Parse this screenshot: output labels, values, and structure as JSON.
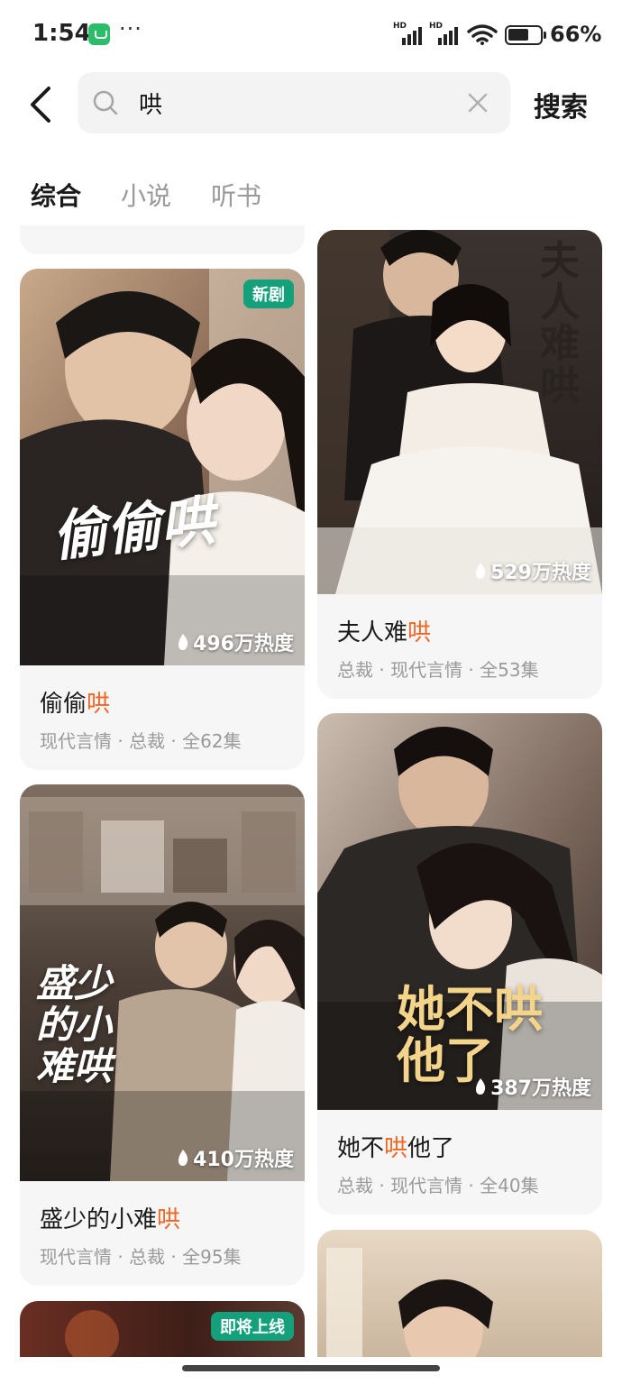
{
  "status_bar": {
    "time": "1:54",
    "dots": "···",
    "signal1": "HD",
    "signal2": "HD",
    "battery_text": "66%"
  },
  "search": {
    "back_icon": "back-chevron-icon",
    "search_icon": "search-icon",
    "query": "哄",
    "clear_icon": "clear-icon",
    "submit_label": "搜索"
  },
  "tabs": [
    {
      "label": "综合",
      "active": true
    },
    {
      "label": "小说",
      "active": false
    },
    {
      "label": "听书",
      "active": false
    }
  ],
  "colors": {
    "highlight": "#f26522",
    "badge_green": "#14a07a",
    "tag_gray": "#9a9a9a"
  },
  "cards": [
    {
      "badge": "新剧",
      "heat": "496万热度",
      "cover_title": "偷偷哄",
      "title_before": "偷偷",
      "title_hl": "哄",
      "title_after": "",
      "tags": "现代言情 · 总裁 · 全62集"
    },
    {
      "badge": "",
      "heat": "529万热度",
      "cover_title": "夫人难哄",
      "title_before": "夫人难",
      "title_hl": "哄",
      "title_after": "",
      "tags": "总裁 · 现代言情 · 全53集"
    },
    {
      "badge": "",
      "heat": "410万热度",
      "cover_title": "盛少的小难哄",
      "title_before": "盛少的小难",
      "title_hl": "哄",
      "title_after": "",
      "tags": "现代言情 · 总裁 · 全95集"
    },
    {
      "badge": "",
      "heat": "387万热度",
      "cover_title": "她不哄他了",
      "title_before": "她不",
      "title_hl": "哄",
      "title_after": "他了",
      "tags": "总裁 · 现代言情 · 全40集"
    },
    {
      "badge": "即将上线"
    }
  ]
}
